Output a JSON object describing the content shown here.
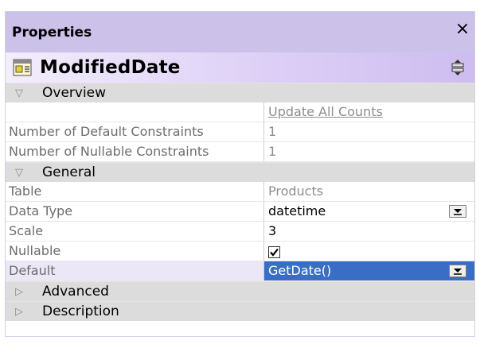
{
  "panel": {
    "title": "Properties",
    "close_glyph": "×"
  },
  "object": {
    "name": "ModifiedDate",
    "icon": "column-icon",
    "sort_icon": "sort-toggle-icon"
  },
  "sections": [
    {
      "label": "Overview",
      "expanded": true,
      "rows": [
        {
          "name": "",
          "value": "Update All Counts",
          "style": "link"
        },
        {
          "name": "Number of Default Constraints",
          "value": "1",
          "style": "gray"
        },
        {
          "name": "Number of Nullable Constraints",
          "value": "1",
          "style": "gray"
        }
      ]
    },
    {
      "label": "General",
      "expanded": true,
      "rows": [
        {
          "name": "Table",
          "value": "Products",
          "style": "gray"
        },
        {
          "name": "Data Type",
          "value": "datetime",
          "style": "dropdown"
        },
        {
          "name": "Scale",
          "value": "3",
          "style": "normal"
        },
        {
          "name": "Nullable",
          "value": "",
          "checked": true,
          "style": "checkbox"
        },
        {
          "name": "Default",
          "value": "GetDate()",
          "style": "dropdown",
          "selected": true
        }
      ]
    },
    {
      "label": "Advanced",
      "expanded": false
    },
    {
      "label": "Description",
      "expanded": false
    }
  ],
  "colors": {
    "title_bar": "#cbc1e9",
    "category_bg": "#dcdcdc",
    "selection": "#3a6ec6"
  }
}
